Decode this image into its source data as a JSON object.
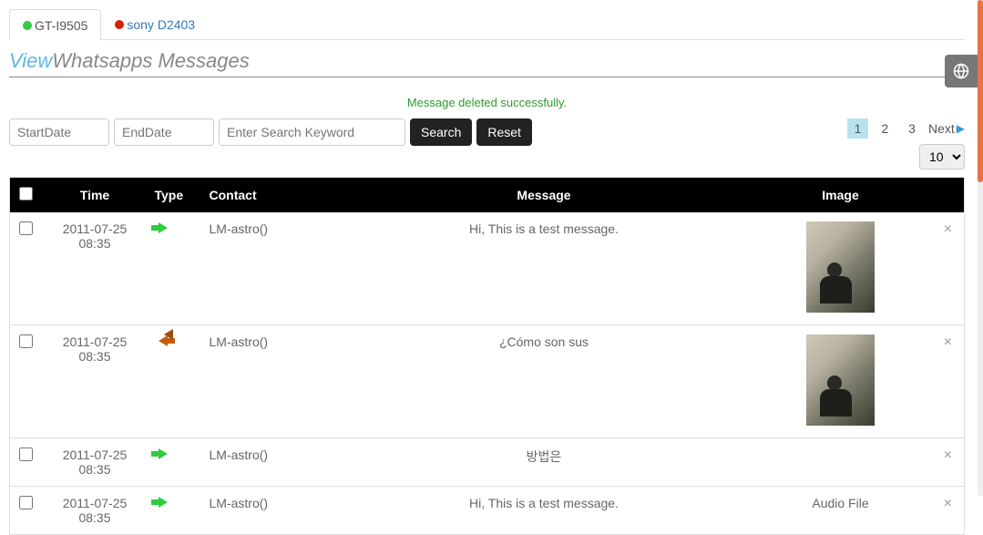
{
  "tabs": [
    {
      "label": "GT-I9505",
      "status": "green",
      "active": true
    },
    {
      "label": "sony D2403",
      "status": "red",
      "active": false
    }
  ],
  "title": {
    "view": "View",
    "rest": "Whatsapps Messages"
  },
  "alert": "Message deleted successfully.",
  "search": {
    "start_placeholder": "StartDate",
    "end_placeholder": "EndDate",
    "keyword_placeholder": "Enter Search Keyword",
    "search_btn": "Search",
    "reset_btn": "Reset"
  },
  "pagination": {
    "pages": [
      "1",
      "2",
      "3"
    ],
    "active": "1",
    "next_label": "Next",
    "page_size": "10"
  },
  "table": {
    "headers": {
      "time": "Time",
      "type": "Type",
      "contact": "Contact",
      "message": "Message",
      "image": "Image"
    },
    "rows": [
      {
        "time": "2011-07-25 08:35",
        "type": "out",
        "contact": "LM-astro()",
        "message": "Hi, This is a test message.",
        "has_image": true,
        "del": "×"
      },
      {
        "time": "2011-07-25 08:35",
        "type": "in",
        "contact": "LM-astro()",
        "message": "¿Cómo son sus",
        "has_image": true,
        "del": "×"
      },
      {
        "time": "2011-07-25 08:35",
        "type": "out",
        "contact": "LM-astro()",
        "message": "방법은",
        "has_image": false,
        "del": "×"
      },
      {
        "time": "2011-07-25 08:35",
        "type": "out",
        "contact": "LM-astro()",
        "message": "Hi, This is a test message.",
        "has_image": false,
        "image_alt": "Audio File",
        "del": "×"
      }
    ]
  }
}
